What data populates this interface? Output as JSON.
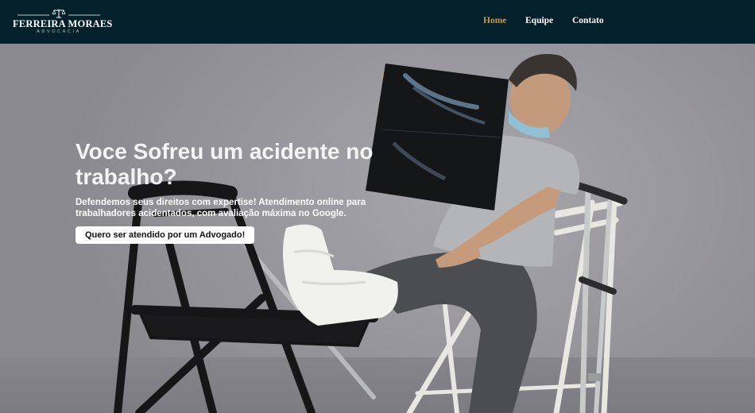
{
  "brand": {
    "name": "FERREIRA MORAES",
    "subtitle": "ADVOCACIA",
    "icon": "scales-of-justice-icon"
  },
  "nav": {
    "items": [
      {
        "label": "Home",
        "active": true
      },
      {
        "label": "Equipe",
        "active": false
      },
      {
        "label": "Contato",
        "active": false
      }
    ],
    "active_color": "#c49a57",
    "background": "#03202b"
  },
  "hero": {
    "title": "Voce Sofreu um acidente no trabalho?",
    "description": "Defendemos seus direitos com expertise! Atendimento online para trabalhadores acidentados, com avaliação máxima no Google.",
    "cta_label": "Quero ser atendido por um Advogado!"
  }
}
